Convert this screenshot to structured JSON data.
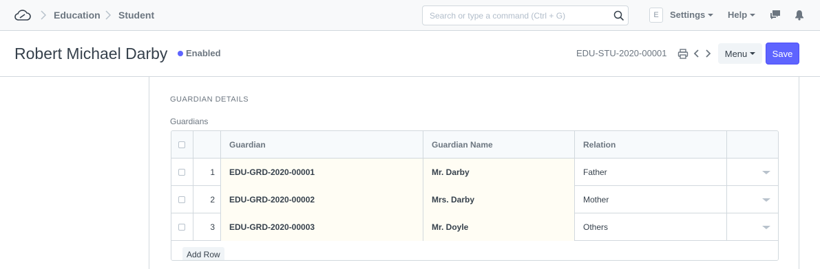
{
  "navbar": {
    "logo_icon": "cloud-logo-icon",
    "breadcrumbs": [
      {
        "label": "Education"
      },
      {
        "label": "Student"
      }
    ],
    "search": {
      "placeholder": "Search or type a command (Ctrl + G)",
      "value": ""
    },
    "avatar_letter": "E",
    "settings_label": "Settings",
    "help_label": "Help",
    "icons": [
      "chat-icon",
      "bell-icon"
    ]
  },
  "page_head": {
    "title": "Robert Michael Darby",
    "status": {
      "label": "Enabled",
      "color": "#5e64ff"
    },
    "doc_id": "EDU-STU-2020-00001",
    "icons": [
      "printer-icon",
      "chevron-left-icon",
      "chevron-right-icon"
    ],
    "menu_label": "Menu",
    "save_label": "Save",
    "accent_color": "#5e64ff"
  },
  "section": {
    "heading": "GUARDIAN DETAILS",
    "field_label": "Guardians",
    "grid": {
      "columns": [
        "Guardian",
        "Guardian Name",
        "Relation"
      ],
      "rows": [
        {
          "idx": "1",
          "guardian": "EDU-GRD-2020-00001",
          "guardian_name": "Mr. Darby",
          "relation": "Father"
        },
        {
          "idx": "2",
          "guardian": "EDU-GRD-2020-00002",
          "guardian_name": "Mrs. Darby",
          "relation": "Mother"
        },
        {
          "idx": "3",
          "guardian": "EDU-GRD-2020-00003",
          "guardian_name": "Mr. Doyle",
          "relation": "Others"
        }
      ],
      "add_row_label": "Add Row"
    }
  }
}
